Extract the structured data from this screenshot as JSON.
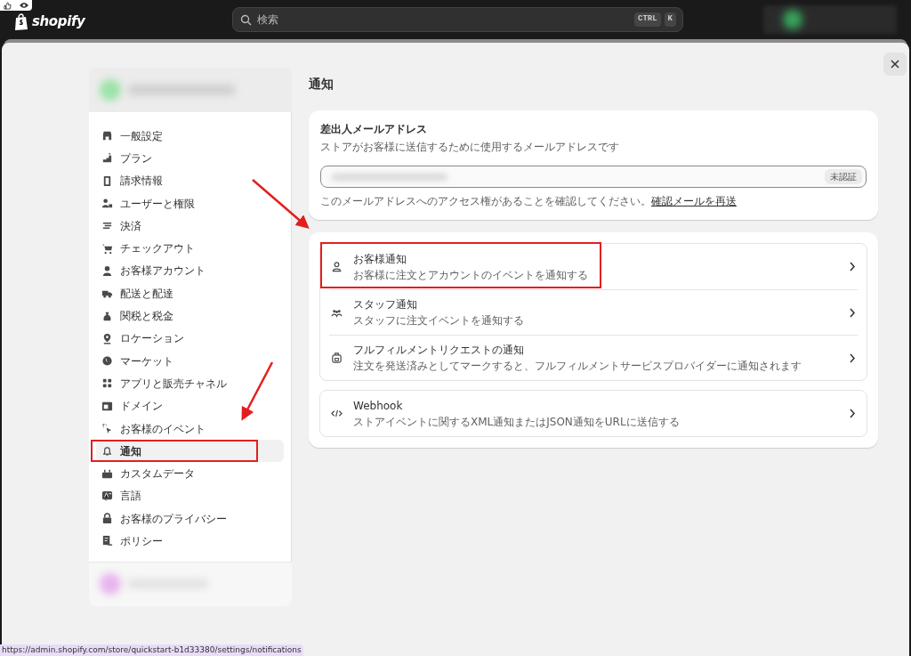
{
  "topbar": {
    "logo": "shopify",
    "search": {
      "placeholder": "検索"
    },
    "shortcut_keys": [
      "CTRL",
      "K"
    ]
  },
  "sidebar": {
    "items": [
      {
        "label": "一般設定",
        "selected": false,
        "annotated": false
      },
      {
        "label": "プラン",
        "selected": false,
        "annotated": false
      },
      {
        "label": "請求情報",
        "selected": false,
        "annotated": false
      },
      {
        "label": "ユーザーと権限",
        "selected": false,
        "annotated": false
      },
      {
        "label": "決済",
        "selected": false,
        "annotated": false
      },
      {
        "label": "チェックアウト",
        "selected": false,
        "annotated": false
      },
      {
        "label": "お客様アカウント",
        "selected": false,
        "annotated": false
      },
      {
        "label": "配送と配達",
        "selected": false,
        "annotated": false
      },
      {
        "label": "関税と税金",
        "selected": false,
        "annotated": false
      },
      {
        "label": "ロケーション",
        "selected": false,
        "annotated": false
      },
      {
        "label": "マーケット",
        "selected": false,
        "annotated": false
      },
      {
        "label": "アプリと販売チャネル",
        "selected": false,
        "annotated": false
      },
      {
        "label": "ドメイン",
        "selected": false,
        "annotated": false
      },
      {
        "label": "お客様のイベント",
        "selected": false,
        "annotated": false
      },
      {
        "label": "通知",
        "selected": true,
        "annotated": true
      },
      {
        "label": "カスタムデータ",
        "selected": false,
        "annotated": false
      },
      {
        "label": "言語",
        "selected": false,
        "annotated": false
      },
      {
        "label": "お客様のプライバシー",
        "selected": false,
        "annotated": false
      },
      {
        "label": "ポリシー",
        "selected": false,
        "annotated": false
      }
    ]
  },
  "page": {
    "title": "通知",
    "sender_email": {
      "title": "差出人メールアドレス",
      "description": "ストアがお客様に送信するために使用するメールアドレスです",
      "badge": "未認証",
      "note": "このメールアドレスへのアクセス権があることを確認してください。",
      "link": "確認メールを再送"
    },
    "groups": [
      [
        {
          "title": "お客様通知",
          "description": "お客様に注文とアカウントのイベントを通知する",
          "annotated": true
        },
        {
          "title": "スタッフ通知",
          "description": "スタッフに注文イベントを通知する",
          "annotated": false
        },
        {
          "title": "フルフィルメントリクエストの通知",
          "description": "注文を発送済みとしてマークすると、フルフィルメントサービスプロバイダーに通知されます",
          "annotated": false
        }
      ],
      [
        {
          "title": "Webhook",
          "description": "ストアイベントに関するXML通知またはJSON通知をURLに送信する",
          "annotated": false
        }
      ]
    ]
  },
  "status_url": "https://admin.shopify.com/store/quickstart-b1d33380/settings/notifications"
}
